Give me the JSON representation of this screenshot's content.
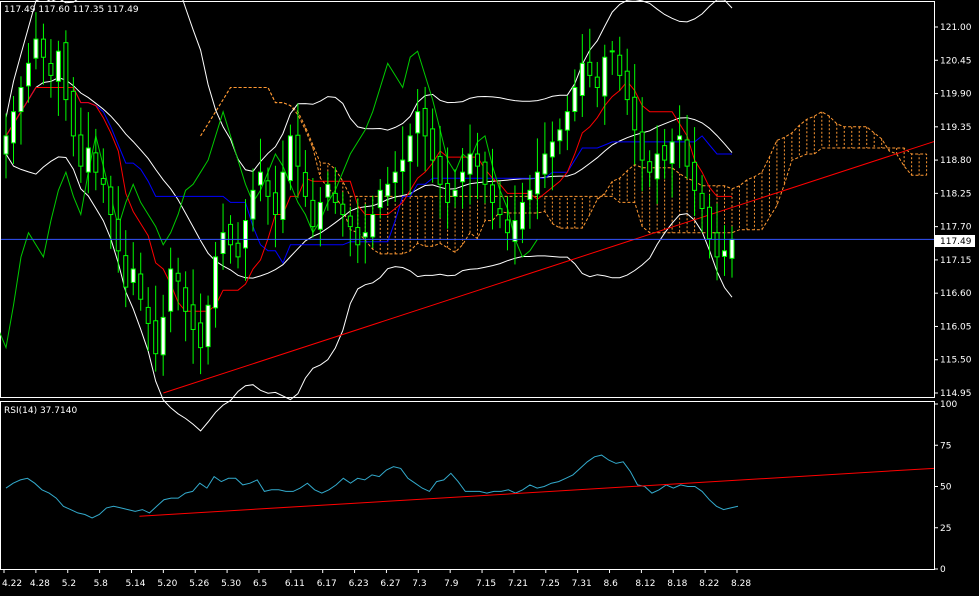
{
  "header": {
    "ohlc_text": "117.49 117.60 117.35 117.49"
  },
  "price_panel": {
    "current_price": 117.49,
    "current_price_label": "117.49",
    "y_ticks": [
      "121.00",
      "120.45",
      "119.90",
      "119.35",
      "118.80",
      "118.25",
      "117.70",
      "117.15",
      "116.60",
      "116.05",
      "115.50",
      "114.95"
    ],
    "y_min": 114.95,
    "y_max": 121.0
  },
  "rsi_panel": {
    "label": "RSI(14)  37.7140",
    "y_ticks": [
      "100",
      "75",
      "50",
      "25",
      "0"
    ],
    "y_min": 0,
    "y_max": 100
  },
  "x_axis": {
    "labels": [
      "4.22",
      "4.28",
      "5.2",
      "5.8",
      "5.14",
      "5.20",
      "5.26",
      "5.30",
      "6.5",
      "6.11",
      "6.17",
      "6.23",
      "6.27",
      "7.3",
      "7.9",
      "7.15",
      "7.21",
      "7.25",
      "7.31",
      "8.6",
      "8.12",
      "8.18",
      "8.22",
      "8.28"
    ]
  },
  "colors": {
    "background": "#000000",
    "grid_frame": "#ffffff",
    "bollinger": "#ffffff",
    "tenkan": "#ff0000",
    "kijun": "#0000ff",
    "chikou": "#00cc00",
    "kumo": "#ff9933",
    "candle_up": "#ffffff",
    "candle_down": "#000000",
    "candle_wick": "#00ff00",
    "trendline": "#ff0000",
    "rsi_line": "#33aacc",
    "price_line": "#3355ff"
  },
  "chart_data": [
    {
      "type": "candlestick",
      "title": "",
      "indicators": [
        "Ichimoku",
        "Bollinger Bands"
      ],
      "ylim": [
        114.95,
        121.0
      ],
      "closes": [
        119.2,
        119.6,
        120.0,
        120.4,
        120.8,
        120.5,
        120.2,
        120.6,
        119.8,
        119.2,
        118.7,
        119.0,
        118.6,
        118.4,
        117.9,
        117.3,
        116.7,
        117.0,
        116.5,
        116.1,
        115.6,
        116.2,
        117.0,
        116.8,
        116.3,
        116.0,
        115.7,
        116.4,
        117.2,
        117.6,
        117.4,
        117.2,
        117.8,
        118.3,
        118.6,
        118.2,
        117.9,
        118.6,
        119.2,
        118.7,
        118.2,
        117.7,
        118.1,
        118.4,
        118.1,
        117.9,
        117.7,
        117.4,
        117.6,
        117.9,
        118.3,
        118.4,
        118.6,
        118.8,
        119.2,
        119.6,
        119.2,
        118.8,
        118.4,
        118.1,
        118.3,
        118.6,
        118.9,
        118.7,
        118.4,
        118.1,
        117.9,
        117.6,
        117.8,
        118.1,
        118.3,
        118.6,
        118.9,
        119.1,
        119.3,
        119.6,
        120.0,
        120.4,
        120.2,
        120.0,
        120.5,
        120.6,
        120.2,
        119.8,
        119.3,
        118.8,
        118.6,
        118.9,
        118.8,
        119.1,
        119.2,
        118.7,
        118.3,
        118.0,
        117.5,
        117.2,
        117.3,
        117.49
      ],
      "bollinger_upper_range": [
        119.9,
        121.0
      ],
      "kijun_last": 118.85,
      "tenkan_last": 118.45,
      "trendline_from": [
        "5.20",
        114.95
      ],
      "trendline_through": [
        "8.18",
        117.7
      ]
    },
    {
      "type": "line",
      "title": "",
      "ylim": [
        0,
        100
      ],
      "series": [
        {
          "name": "RSI(14)",
          "values": [
            49,
            52,
            54,
            55,
            52,
            48,
            46,
            43,
            38,
            36,
            34,
            33,
            31,
            33,
            37,
            38,
            37,
            36,
            35,
            36,
            34,
            38,
            42,
            43,
            43,
            46,
            47,
            52,
            49,
            56,
            53,
            55,
            55,
            51,
            52,
            54,
            47,
            48,
            48,
            47,
            47,
            49,
            52,
            48,
            46,
            48,
            51,
            55,
            52,
            55,
            54,
            57,
            56,
            60,
            62,
            61,
            55,
            52,
            49,
            47,
            53,
            54,
            58,
            53,
            47,
            47,
            47,
            46,
            47,
            47,
            48,
            46,
            48,
            51,
            49,
            50,
            52,
            53,
            55,
            57,
            61,
            65,
            68,
            69,
            66,
            64,
            65,
            59,
            51,
            50,
            46,
            48,
            51,
            49,
            51,
            50,
            50,
            47,
            42,
            38,
            36,
            37,
            38
          ]
        }
      ],
      "trendline_from": [
        "5.14",
        32
      ],
      "trendline_to": [
        "end",
        61
      ]
    }
  ]
}
